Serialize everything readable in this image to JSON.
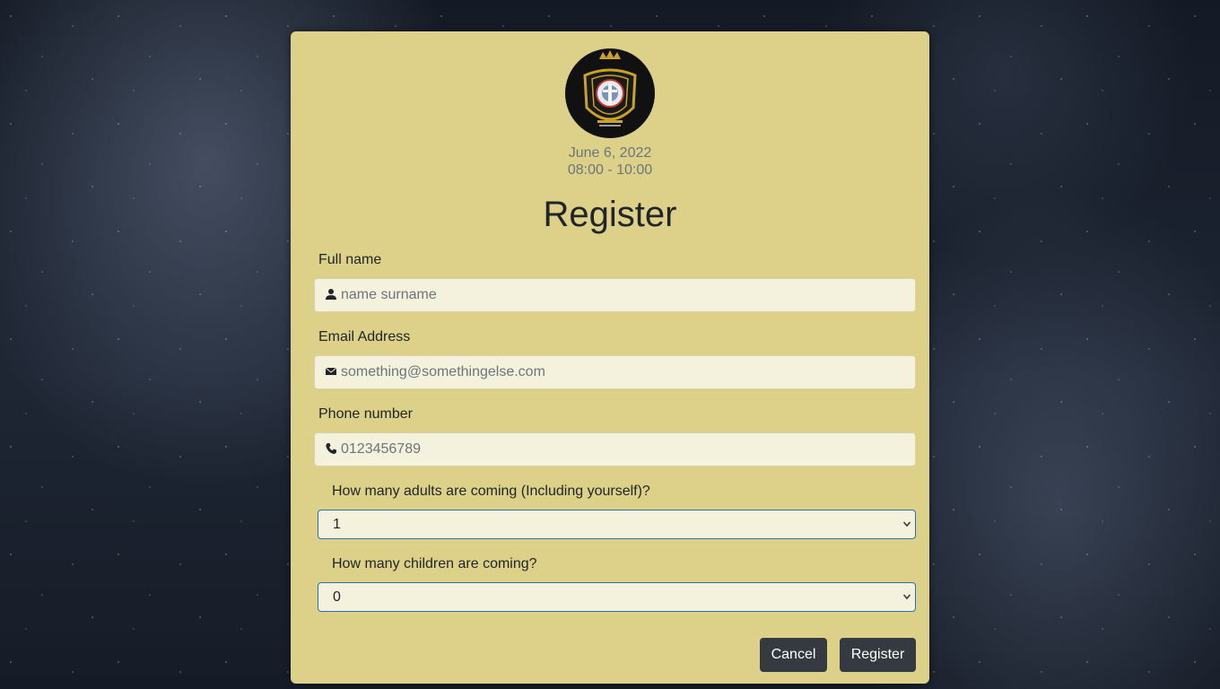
{
  "event": {
    "date": "June 6, 2022",
    "time": "08:00 - 10:00"
  },
  "form": {
    "title": "Register",
    "full_name": {
      "label": "Full name",
      "placeholder": "name surname",
      "icon": "person-icon"
    },
    "email": {
      "label": "Email Address",
      "placeholder": "something@somethingelse.com",
      "icon": "envelope-icon"
    },
    "phone": {
      "label": "Phone number",
      "placeholder": "0123456789",
      "icon": "phone-icon"
    },
    "adults": {
      "label": "How many adults are coming (Including yourself)?",
      "selected": "1"
    },
    "children": {
      "label": "How many children are coming?",
      "selected": "0"
    },
    "cancel_label": "Cancel",
    "register_label": "Register"
  },
  "colors": {
    "card_background": "#ddd089",
    "button_background": "#343a40",
    "select_border": "#2d6fb0"
  }
}
